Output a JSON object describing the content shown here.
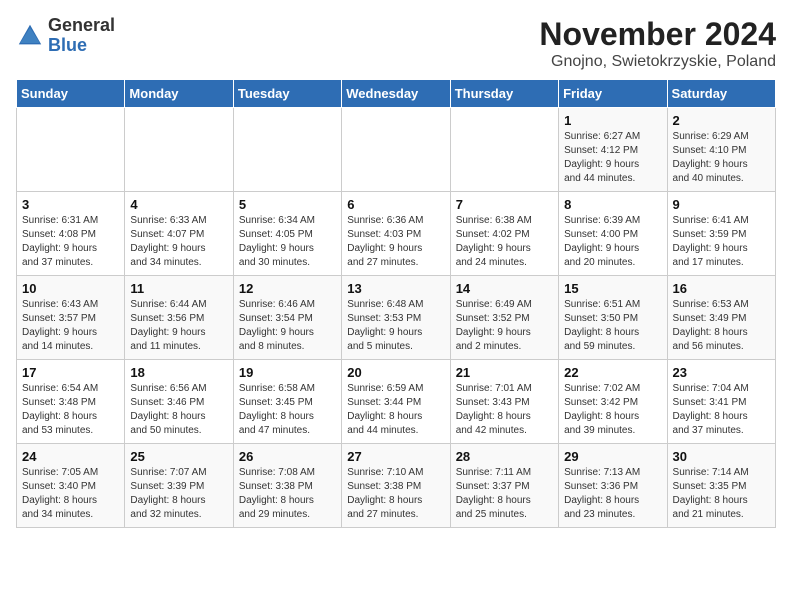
{
  "logo": {
    "general": "General",
    "blue": "Blue"
  },
  "header": {
    "month": "November 2024",
    "location": "Gnojno, Swietokrzyskie, Poland"
  },
  "columns": [
    "Sunday",
    "Monday",
    "Tuesday",
    "Wednesday",
    "Thursday",
    "Friday",
    "Saturday"
  ],
  "weeks": [
    [
      {
        "day": "",
        "info": ""
      },
      {
        "day": "",
        "info": ""
      },
      {
        "day": "",
        "info": ""
      },
      {
        "day": "",
        "info": ""
      },
      {
        "day": "",
        "info": ""
      },
      {
        "day": "1",
        "info": "Sunrise: 6:27 AM\nSunset: 4:12 PM\nDaylight: 9 hours\nand 44 minutes."
      },
      {
        "day": "2",
        "info": "Sunrise: 6:29 AM\nSunset: 4:10 PM\nDaylight: 9 hours\nand 40 minutes."
      }
    ],
    [
      {
        "day": "3",
        "info": "Sunrise: 6:31 AM\nSunset: 4:08 PM\nDaylight: 9 hours\nand 37 minutes."
      },
      {
        "day": "4",
        "info": "Sunrise: 6:33 AM\nSunset: 4:07 PM\nDaylight: 9 hours\nand 34 minutes."
      },
      {
        "day": "5",
        "info": "Sunrise: 6:34 AM\nSunset: 4:05 PM\nDaylight: 9 hours\nand 30 minutes."
      },
      {
        "day": "6",
        "info": "Sunrise: 6:36 AM\nSunset: 4:03 PM\nDaylight: 9 hours\nand 27 minutes."
      },
      {
        "day": "7",
        "info": "Sunrise: 6:38 AM\nSunset: 4:02 PM\nDaylight: 9 hours\nand 24 minutes."
      },
      {
        "day": "8",
        "info": "Sunrise: 6:39 AM\nSunset: 4:00 PM\nDaylight: 9 hours\nand 20 minutes."
      },
      {
        "day": "9",
        "info": "Sunrise: 6:41 AM\nSunset: 3:59 PM\nDaylight: 9 hours\nand 17 minutes."
      }
    ],
    [
      {
        "day": "10",
        "info": "Sunrise: 6:43 AM\nSunset: 3:57 PM\nDaylight: 9 hours\nand 14 minutes."
      },
      {
        "day": "11",
        "info": "Sunrise: 6:44 AM\nSunset: 3:56 PM\nDaylight: 9 hours\nand 11 minutes."
      },
      {
        "day": "12",
        "info": "Sunrise: 6:46 AM\nSunset: 3:54 PM\nDaylight: 9 hours\nand 8 minutes."
      },
      {
        "day": "13",
        "info": "Sunrise: 6:48 AM\nSunset: 3:53 PM\nDaylight: 9 hours\nand 5 minutes."
      },
      {
        "day": "14",
        "info": "Sunrise: 6:49 AM\nSunset: 3:52 PM\nDaylight: 9 hours\nand 2 minutes."
      },
      {
        "day": "15",
        "info": "Sunrise: 6:51 AM\nSunset: 3:50 PM\nDaylight: 8 hours\nand 59 minutes."
      },
      {
        "day": "16",
        "info": "Sunrise: 6:53 AM\nSunset: 3:49 PM\nDaylight: 8 hours\nand 56 minutes."
      }
    ],
    [
      {
        "day": "17",
        "info": "Sunrise: 6:54 AM\nSunset: 3:48 PM\nDaylight: 8 hours\nand 53 minutes."
      },
      {
        "day": "18",
        "info": "Sunrise: 6:56 AM\nSunset: 3:46 PM\nDaylight: 8 hours\nand 50 minutes."
      },
      {
        "day": "19",
        "info": "Sunrise: 6:58 AM\nSunset: 3:45 PM\nDaylight: 8 hours\nand 47 minutes."
      },
      {
        "day": "20",
        "info": "Sunrise: 6:59 AM\nSunset: 3:44 PM\nDaylight: 8 hours\nand 44 minutes."
      },
      {
        "day": "21",
        "info": "Sunrise: 7:01 AM\nSunset: 3:43 PM\nDaylight: 8 hours\nand 42 minutes."
      },
      {
        "day": "22",
        "info": "Sunrise: 7:02 AM\nSunset: 3:42 PM\nDaylight: 8 hours\nand 39 minutes."
      },
      {
        "day": "23",
        "info": "Sunrise: 7:04 AM\nSunset: 3:41 PM\nDaylight: 8 hours\nand 37 minutes."
      }
    ],
    [
      {
        "day": "24",
        "info": "Sunrise: 7:05 AM\nSunset: 3:40 PM\nDaylight: 8 hours\nand 34 minutes."
      },
      {
        "day": "25",
        "info": "Sunrise: 7:07 AM\nSunset: 3:39 PM\nDaylight: 8 hours\nand 32 minutes."
      },
      {
        "day": "26",
        "info": "Sunrise: 7:08 AM\nSunset: 3:38 PM\nDaylight: 8 hours\nand 29 minutes."
      },
      {
        "day": "27",
        "info": "Sunrise: 7:10 AM\nSunset: 3:38 PM\nDaylight: 8 hours\nand 27 minutes."
      },
      {
        "day": "28",
        "info": "Sunrise: 7:11 AM\nSunset: 3:37 PM\nDaylight: 8 hours\nand 25 minutes."
      },
      {
        "day": "29",
        "info": "Sunrise: 7:13 AM\nSunset: 3:36 PM\nDaylight: 8 hours\nand 23 minutes."
      },
      {
        "day": "30",
        "info": "Sunrise: 7:14 AM\nSunset: 3:35 PM\nDaylight: 8 hours\nand 21 minutes."
      }
    ]
  ]
}
